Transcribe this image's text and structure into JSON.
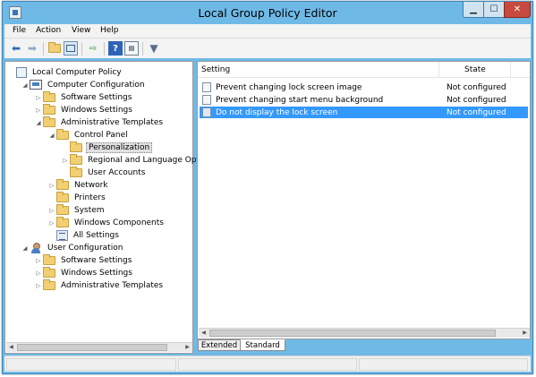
{
  "window": {
    "title": "Local Group Policy Editor",
    "controls": [
      "minimize",
      "maximize",
      "close"
    ]
  },
  "menu": [
    "File",
    "Action",
    "View",
    "Help"
  ],
  "toolbar": {
    "icons": [
      "back-arrow-icon",
      "forward-arrow-icon",
      "up-folder-icon",
      "show-hide-tree-icon",
      "export-list-icon",
      "help-icon",
      "properties-icon",
      "filter-icon"
    ]
  },
  "tree": [
    {
      "label": "Local Computer Policy",
      "icon": "document",
      "expander": "",
      "selected": false
    },
    {
      "label": "Computer Configuration",
      "icon": "computer",
      "expander": "expanded",
      "selected": false
    },
    {
      "label": "Software Settings",
      "icon": "folder",
      "expander": "collapsed",
      "selected": false
    },
    {
      "label": "Windows Settings",
      "icon": "folder",
      "expander": "collapsed",
      "selected": false
    },
    {
      "label": "Administrative Templates",
      "icon": "folder",
      "expander": "expanded",
      "selected": false
    },
    {
      "label": "Control Panel",
      "icon": "folder",
      "expander": "expanded",
      "selected": false
    },
    {
      "label": "Personalization",
      "icon": "folder",
      "expander": "",
      "selected": true
    },
    {
      "label": "Regional and Language Options",
      "icon": "folder",
      "expander": "collapsed",
      "selected": false
    },
    {
      "label": "User Accounts",
      "icon": "folder",
      "expander": "",
      "selected": false
    },
    {
      "label": "Network",
      "icon": "folder",
      "expander": "collapsed",
      "selected": false
    },
    {
      "label": "Printers",
      "icon": "folder",
      "expander": "",
      "selected": false
    },
    {
      "label": "System",
      "icon": "folder",
      "expander": "collapsed",
      "selected": false
    },
    {
      "label": "Windows Components",
      "icon": "folder",
      "expander": "collapsed",
      "selected": false
    },
    {
      "label": "All Settings",
      "icon": "all-settings",
      "expander": "",
      "selected": false
    },
    {
      "label": "User Configuration",
      "icon": "user",
      "expander": "expanded",
      "selected": false
    },
    {
      "label": "Software Settings",
      "icon": "folder",
      "expander": "collapsed",
      "selected": false
    },
    {
      "label": "Windows Settings",
      "icon": "folder",
      "expander": "collapsed",
      "selected": false
    },
    {
      "label": "Administrative Templates",
      "icon": "folder",
      "expander": "collapsed",
      "selected": false
    }
  ],
  "list": {
    "columns": [
      "Setting",
      "State"
    ],
    "rows": [
      {
        "setting": "Prevent changing lock screen image",
        "state": "Not configured",
        "selected": false
      },
      {
        "setting": "Prevent changing start menu background",
        "state": "Not configured",
        "selected": false
      },
      {
        "setting": "Do not display the lock screen",
        "state": "Not configured",
        "selected": true
      }
    ]
  },
  "tabs": [
    {
      "label": "Extended",
      "active": false
    },
    {
      "label": "Standard",
      "active": true
    }
  ],
  "colors": {
    "title_bar": "#6fb9e7",
    "selection": "#3399ff",
    "close_button": "#c74a3e",
    "folder": "#f1cf72"
  }
}
